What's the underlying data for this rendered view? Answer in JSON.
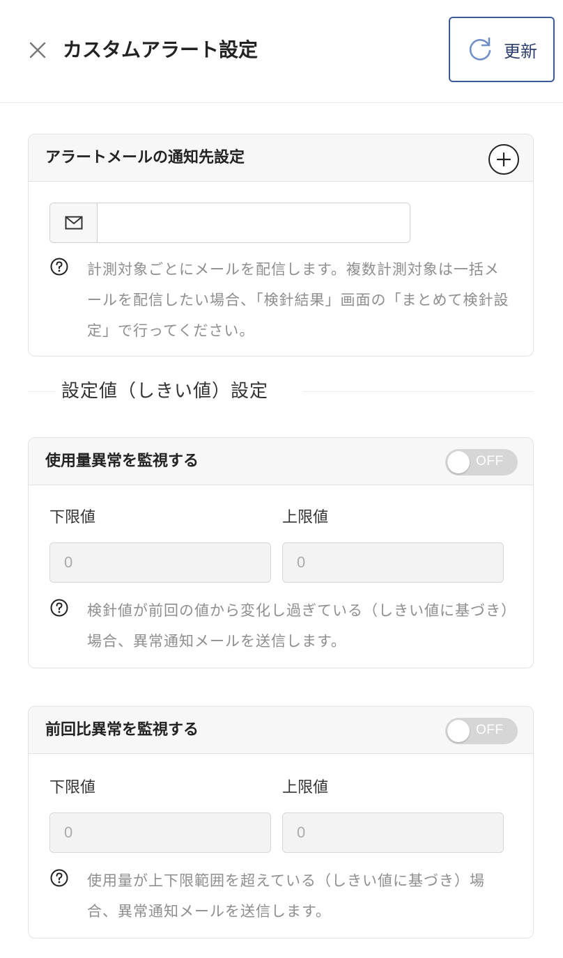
{
  "header": {
    "title": "カスタムアラート設定",
    "refresh_label": "更新"
  },
  "email_card": {
    "title": "アラートメールの通知先設定",
    "email_value": "",
    "hint": "計測対象ごとにメールを配信します。複数計測対象は一括メールを配信したい場合、「検針結果」画面の「まとめて検針設定」で行ってください。"
  },
  "threshold_section": {
    "title": "設定値（しきい値）設定"
  },
  "usage_card": {
    "title": "使用量異常を監視する",
    "toggle_state": "OFF",
    "lower_label": "下限値",
    "upper_label": "上限値",
    "lower_value": "0",
    "upper_value": "0",
    "hint": "検針値が前回の値から変化し過ぎている（しきい値に基づき）場合、異常通知メールを送信します。"
  },
  "ratio_card": {
    "title": "前回比異常を監視する",
    "toggle_state": "OFF",
    "lower_label": "下限値",
    "upper_label": "上限値",
    "lower_value": "0",
    "upper_value": "0",
    "hint": "使用量が上下限範囲を超えている（しきい値に基づき）場合、異常通知メールを送信します。"
  },
  "colors": {
    "accent_border": "#3b5998",
    "toggle_off": "#d6d6d6",
    "hint_text": "#8e8e8e"
  }
}
